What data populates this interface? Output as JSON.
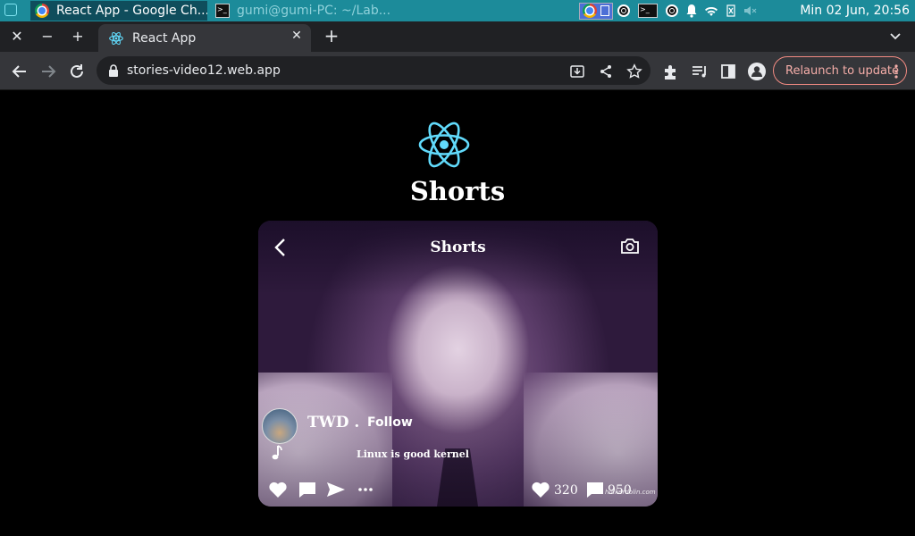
{
  "os": {
    "tasks": [
      {
        "label": "React App - Google Ch...",
        "icon": "chrome-icon",
        "active": true
      },
      {
        "label": "gumi@gumi-PC: ~/Lab...",
        "icon": "terminal-icon",
        "active": false
      }
    ],
    "clock": "Min 02 Jun, 20:56"
  },
  "browser": {
    "tab_title": "React App",
    "url": "stories-video12.web.app",
    "relaunch_label": "Relaunch to update",
    "accent": "#f28b82"
  },
  "page": {
    "heading": "Shorts",
    "logo_icon": "react-logo-icon",
    "logo_color": "#61dafb"
  },
  "video": {
    "header_title": "Shorts",
    "username": "TWD .",
    "follow_label": "Follow",
    "caption": "Linux is good kernel",
    "likes": "320",
    "comments": "950",
    "watermark": "hd.kerdolin.com"
  }
}
